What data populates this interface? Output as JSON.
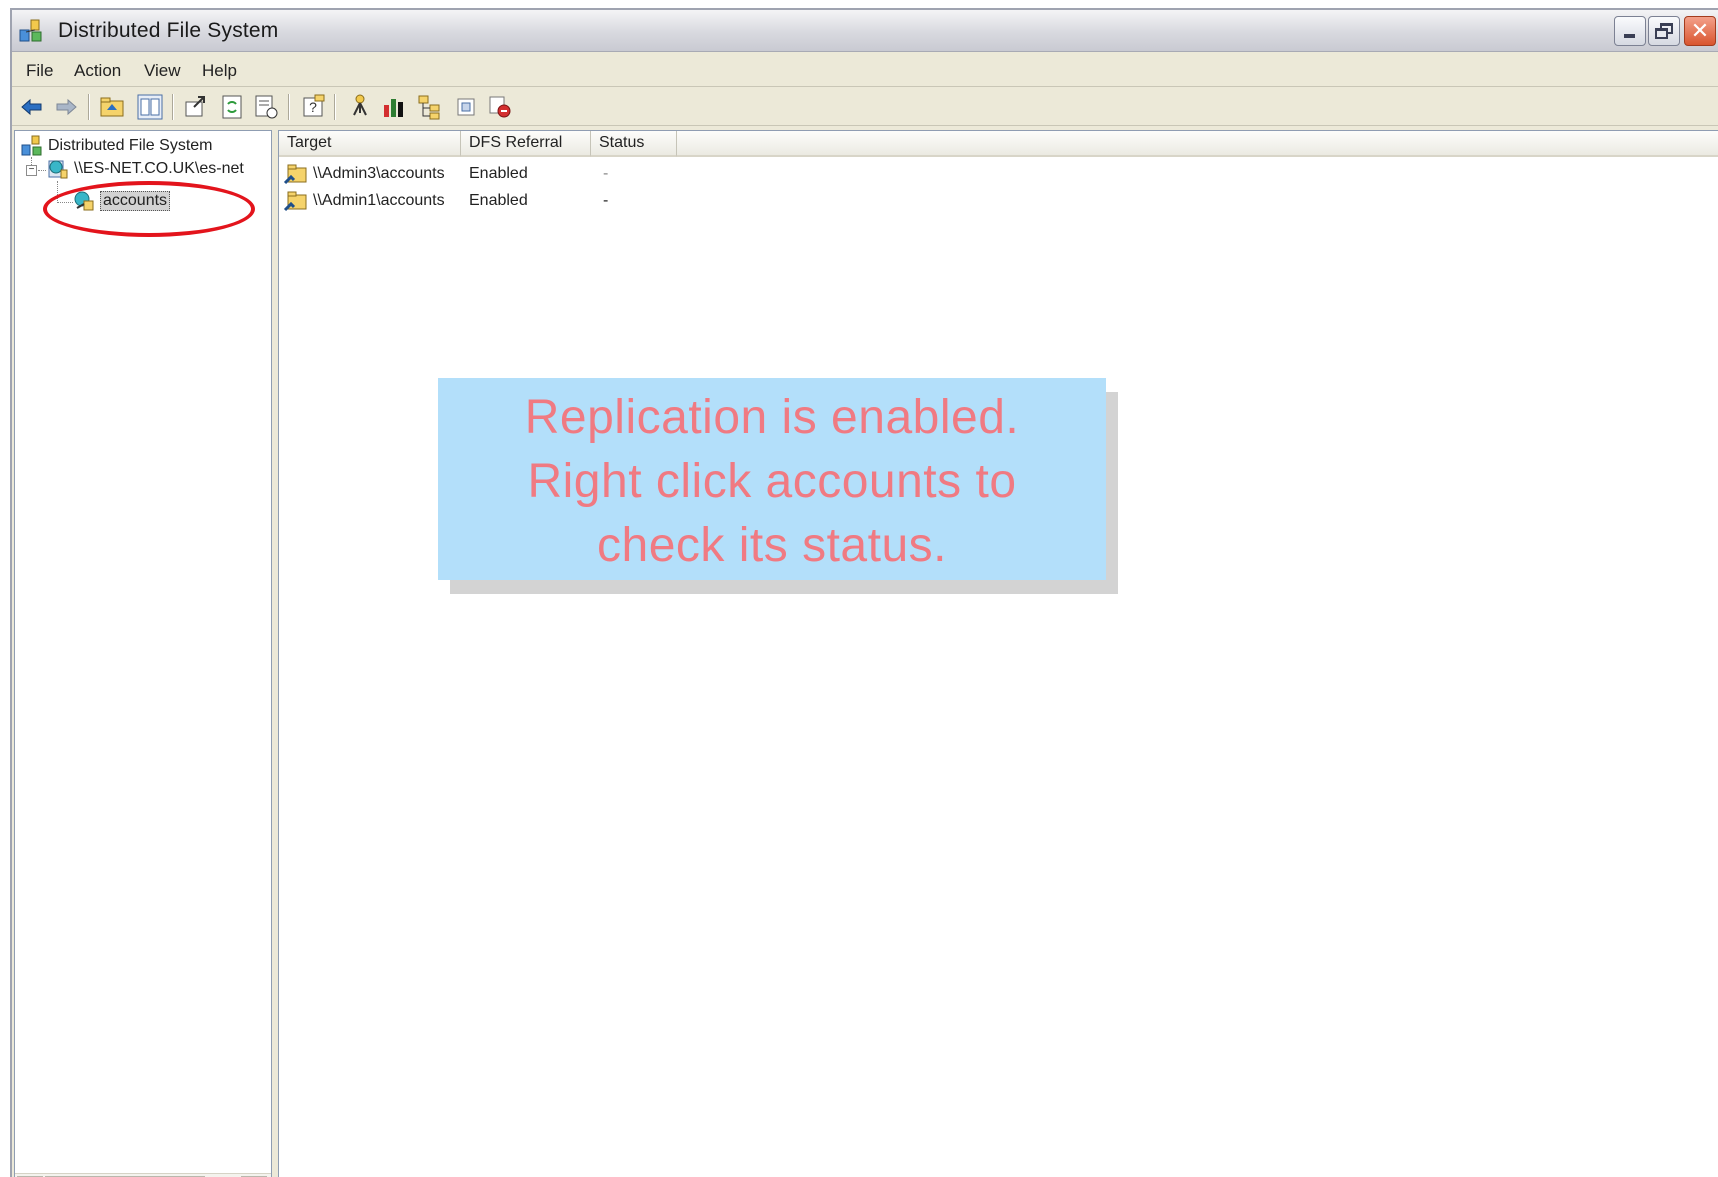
{
  "window": {
    "title": "Distributed File System"
  },
  "menu": [
    "File",
    "Action",
    "View",
    "Help"
  ],
  "toolbar": {
    "icons": [
      "back-icon",
      "forward-icon",
      "up-folder-icon",
      "show-hide-tree-icon",
      "export-list-icon",
      "refresh-icon",
      "properties-icon",
      "help-icon",
      "new-root-icon",
      "replication-status-icon",
      "new-link-icon",
      "new-target-icon",
      "remove-icon"
    ]
  },
  "tree": {
    "root": "Distributed File System",
    "namespace": "\\\\ES-NET.CO.UK\\es-net",
    "selected": "accounts"
  },
  "list": {
    "columns": [
      "Target",
      "DFS Referral",
      "Status"
    ],
    "rows": [
      {
        "target": "\\\\Admin3\\accounts",
        "referral": "Enabled",
        "status": "-"
      },
      {
        "target": "\\\\Admin1\\accounts",
        "referral": "Enabled",
        "status": "-"
      }
    ]
  },
  "callout": {
    "line1": "Replication is enabled.",
    "line2": "Right click accounts to",
    "line3": "check its status."
  },
  "colors": {
    "highlight_ring": "#e3141c",
    "callout_bg": "#b3dffa",
    "callout_text": "#f07a82"
  }
}
